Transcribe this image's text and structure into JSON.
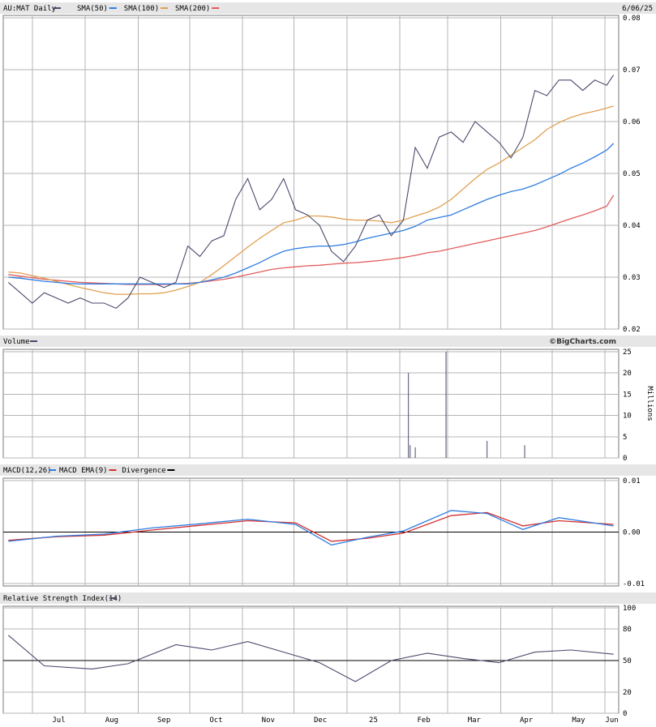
{
  "header": {
    "symbol_label": "AU:MAT Daily",
    "date_label": "6/06/25",
    "legend": [
      {
        "label": "SMA(50)",
        "color": "#2f7de1"
      },
      {
        "label": "SMA(100)",
        "color": "#e0a050"
      },
      {
        "label": "SMA(200)",
        "color": "#e35d5d"
      }
    ],
    "symbol_color": "#4a4a6e"
  },
  "watermark": "©BigCharts.com",
  "colors": {
    "price": "#4a4a6e",
    "sma50": "#2f7de1",
    "sma100": "#e0a050",
    "sma200": "#e35d5d",
    "macd": "#2f7de1",
    "ema": "#d33030",
    "rsi": "#4a4a6e",
    "volume": "#4a4a6e"
  },
  "chart_data": [
    {
      "type": "line",
      "title": "AU:MAT Daily",
      "x": [
        "2024-06-17",
        "2024-06-24",
        "2024-07-01",
        "2024-07-08",
        "2024-07-15",
        "2024-07-22",
        "2024-07-29",
        "2024-08-05",
        "2024-08-12",
        "2024-08-19",
        "2024-08-26",
        "2024-09-02",
        "2024-09-09",
        "2024-09-16",
        "2024-09-23",
        "2024-09-30",
        "2024-10-07",
        "2024-10-14",
        "2024-10-21",
        "2024-10-28",
        "2024-11-04",
        "2024-11-11",
        "2024-11-18",
        "2024-11-25",
        "2024-12-02",
        "2024-12-09",
        "2024-12-16",
        "2024-12-23",
        "2024-12-30",
        "2025-01-06",
        "2025-01-13",
        "2025-01-20",
        "2025-01-27",
        "2025-02-03",
        "2025-02-10",
        "2025-02-17",
        "2025-02-24",
        "2025-03-03",
        "2025-03-10",
        "2025-03-17",
        "2025-03-24",
        "2025-03-31",
        "2025-04-07",
        "2025-04-14",
        "2025-04-21",
        "2025-04-28",
        "2025-05-05",
        "2025-05-12",
        "2025-05-19",
        "2025-05-26",
        "2025-06-02",
        "2025-06-06"
      ],
      "series": [
        {
          "name": "AU:MAT",
          "values": [
            0.029,
            0.027,
            0.025,
            0.027,
            0.026,
            0.025,
            0.026,
            0.025,
            0.025,
            0.024,
            0.026,
            0.03,
            0.029,
            0.028,
            0.029,
            0.036,
            0.034,
            0.037,
            0.038,
            0.045,
            0.049,
            0.043,
            0.045,
            0.049,
            0.043,
            0.042,
            0.04,
            0.035,
            0.033,
            0.036,
            0.041,
            0.042,
            0.038,
            0.041,
            0.055,
            0.051,
            0.057,
            0.058,
            0.056,
            0.06,
            0.058,
            0.056,
            0.053,
            0.057,
            0.066,
            0.065,
            0.068,
            0.068,
            0.066,
            0.068,
            0.067,
            0.069
          ]
        },
        {
          "name": "SMA(50)",
          "values": [
            0.03,
            0.0298,
            0.0295,
            0.0292,
            0.029,
            0.0288,
            0.0287,
            0.0287,
            0.0287,
            0.0287,
            0.0287,
            0.0287,
            0.0287,
            0.0287,
            0.0287,
            0.0287,
            0.029,
            0.0295,
            0.03,
            0.0308,
            0.0318,
            0.0328,
            0.034,
            0.035,
            0.0355,
            0.0358,
            0.036,
            0.036,
            0.0363,
            0.0368,
            0.0375,
            0.038,
            0.0385,
            0.039,
            0.0398,
            0.041,
            0.0415,
            0.042,
            0.043,
            0.044,
            0.045,
            0.0458,
            0.0465,
            0.047,
            0.0478,
            0.0488,
            0.0498,
            0.051,
            0.052,
            0.0532,
            0.0545,
            0.0558
          ]
        },
        {
          "name": "SMA(100)",
          "values": [
            0.031,
            0.0308,
            0.0303,
            0.0298,
            0.0292,
            0.0286,
            0.028,
            0.0275,
            0.027,
            0.0267,
            0.0267,
            0.0268,
            0.0268,
            0.027,
            0.0275,
            0.0282,
            0.029,
            0.0305,
            0.0322,
            0.034,
            0.0358,
            0.0375,
            0.039,
            0.0405,
            0.041,
            0.0418,
            0.0418,
            0.0416,
            0.0412,
            0.041,
            0.041,
            0.0408,
            0.0405,
            0.041,
            0.0418,
            0.0425,
            0.0435,
            0.045,
            0.047,
            0.049,
            0.0508,
            0.052,
            0.0535,
            0.055,
            0.0565,
            0.0585,
            0.0598,
            0.0608,
            0.0615,
            0.062,
            0.0626,
            0.063
          ]
        },
        {
          "name": "SMA(200)",
          "values": [
            0.0305,
            0.0302,
            0.0299,
            0.0296,
            0.0294,
            0.0292,
            0.029,
            0.0289,
            0.0288,
            0.0287,
            0.0286,
            0.0286,
            0.0286,
            0.0286,
            0.0287,
            0.0288,
            0.029,
            0.0293,
            0.0296,
            0.03,
            0.0305,
            0.031,
            0.0315,
            0.0318,
            0.032,
            0.0322,
            0.0323,
            0.0325,
            0.0327,
            0.0328,
            0.033,
            0.0332,
            0.0335,
            0.0338,
            0.0342,
            0.0347,
            0.035,
            0.0355,
            0.036,
            0.0365,
            0.037,
            0.0375,
            0.038,
            0.0385,
            0.039,
            0.0397,
            0.0405,
            0.0413,
            0.042,
            0.0428,
            0.0437,
            0.0458
          ]
        }
      ],
      "ylim": [
        0.02,
        0.08
      ],
      "yticks": [
        "0.08",
        "0.07",
        "0.06",
        "0.05",
        "0.04",
        "0.03",
        "0.02"
      ],
      "grid": true
    },
    {
      "type": "bar",
      "title": "Volume",
      "ylabel": "Millions",
      "ylim": [
        0,
        25
      ],
      "yticks": [
        "25",
        "20",
        "15",
        "10",
        "5",
        "0"
      ],
      "x": [
        "2025-02-06",
        "2025-02-07",
        "2025-02-10",
        "2025-02-28",
        "2025-03-24",
        "2025-04-15"
      ],
      "values": [
        20,
        3,
        2.5,
        25,
        4,
        3
      ]
    },
    {
      "type": "line",
      "title": "MACD(12,26)",
      "legend": [
        "MACD EMA(9)",
        "Divergence"
      ],
      "ylim": [
        -0.01,
        0.01
      ],
      "yticks": [
        "0.01",
        "0.00",
        "-0.01"
      ],
      "x": [
        "2024-06-17",
        "2024-07-15",
        "2024-08-12",
        "2024-09-09",
        "2024-10-07",
        "2024-11-04",
        "2024-12-02",
        "2024-12-23",
        "2025-01-13",
        "2025-02-03",
        "2025-03-03",
        "2025-03-24",
        "2025-04-14",
        "2025-05-05",
        "2025-06-06"
      ],
      "series": [
        {
          "name": "MACD(12,26)",
          "values": [
            -0.0018,
            -0.0008,
            -0.0004,
            0.0008,
            0.0016,
            0.0025,
            0.0015,
            -0.0025,
            -0.001,
            0.0002,
            0.0042,
            0.0036,
            0.0005,
            0.0028,
            0.0012
          ]
        },
        {
          "name": "MACD EMA(9)",
          "values": [
            -0.0016,
            -0.0009,
            -0.0006,
            0.0004,
            0.0013,
            0.0022,
            0.0018,
            -0.0018,
            -0.0012,
            -0.0002,
            0.0032,
            0.0038,
            0.0012,
            0.0022,
            0.0015
          ]
        }
      ]
    },
    {
      "type": "line",
      "title": "Relative Strength Index(14)",
      "ylim": [
        0,
        100
      ],
      "yticks": [
        "100",
        "80",
        "50",
        "20",
        "0"
      ],
      "x": [
        "2024-06-17",
        "2024-07-08",
        "2024-08-05",
        "2024-08-26",
        "2024-09-23",
        "2024-10-14",
        "2024-11-04",
        "2024-11-25",
        "2024-12-16",
        "2025-01-06",
        "2025-01-27",
        "2025-02-17",
        "2025-03-10",
        "2025-03-31",
        "2025-04-21",
        "2025-05-12",
        "2025-06-06"
      ],
      "series": [
        {
          "name": "RSI(14)",
          "values": [
            74,
            45,
            42,
            47,
            65,
            60,
            68,
            58,
            48,
            30,
            50,
            57,
            52,
            48,
            58,
            60,
            56
          ]
        }
      ]
    }
  ],
  "xaxis": {
    "months": [
      "Jul",
      "Aug",
      "Sep",
      "Oct",
      "Nov",
      "Dec",
      "25",
      "Feb",
      "Mar",
      "Apr",
      "May",
      "Jun"
    ]
  },
  "panels": {
    "volume_label": "Volume",
    "macd_label": "MACD(12,26)",
    "macd_legend": [
      "MACD EMA(9)",
      "Divergence"
    ],
    "rsi_label": "Relative Strength Index(14)",
    "volume_unit": "Millions"
  }
}
